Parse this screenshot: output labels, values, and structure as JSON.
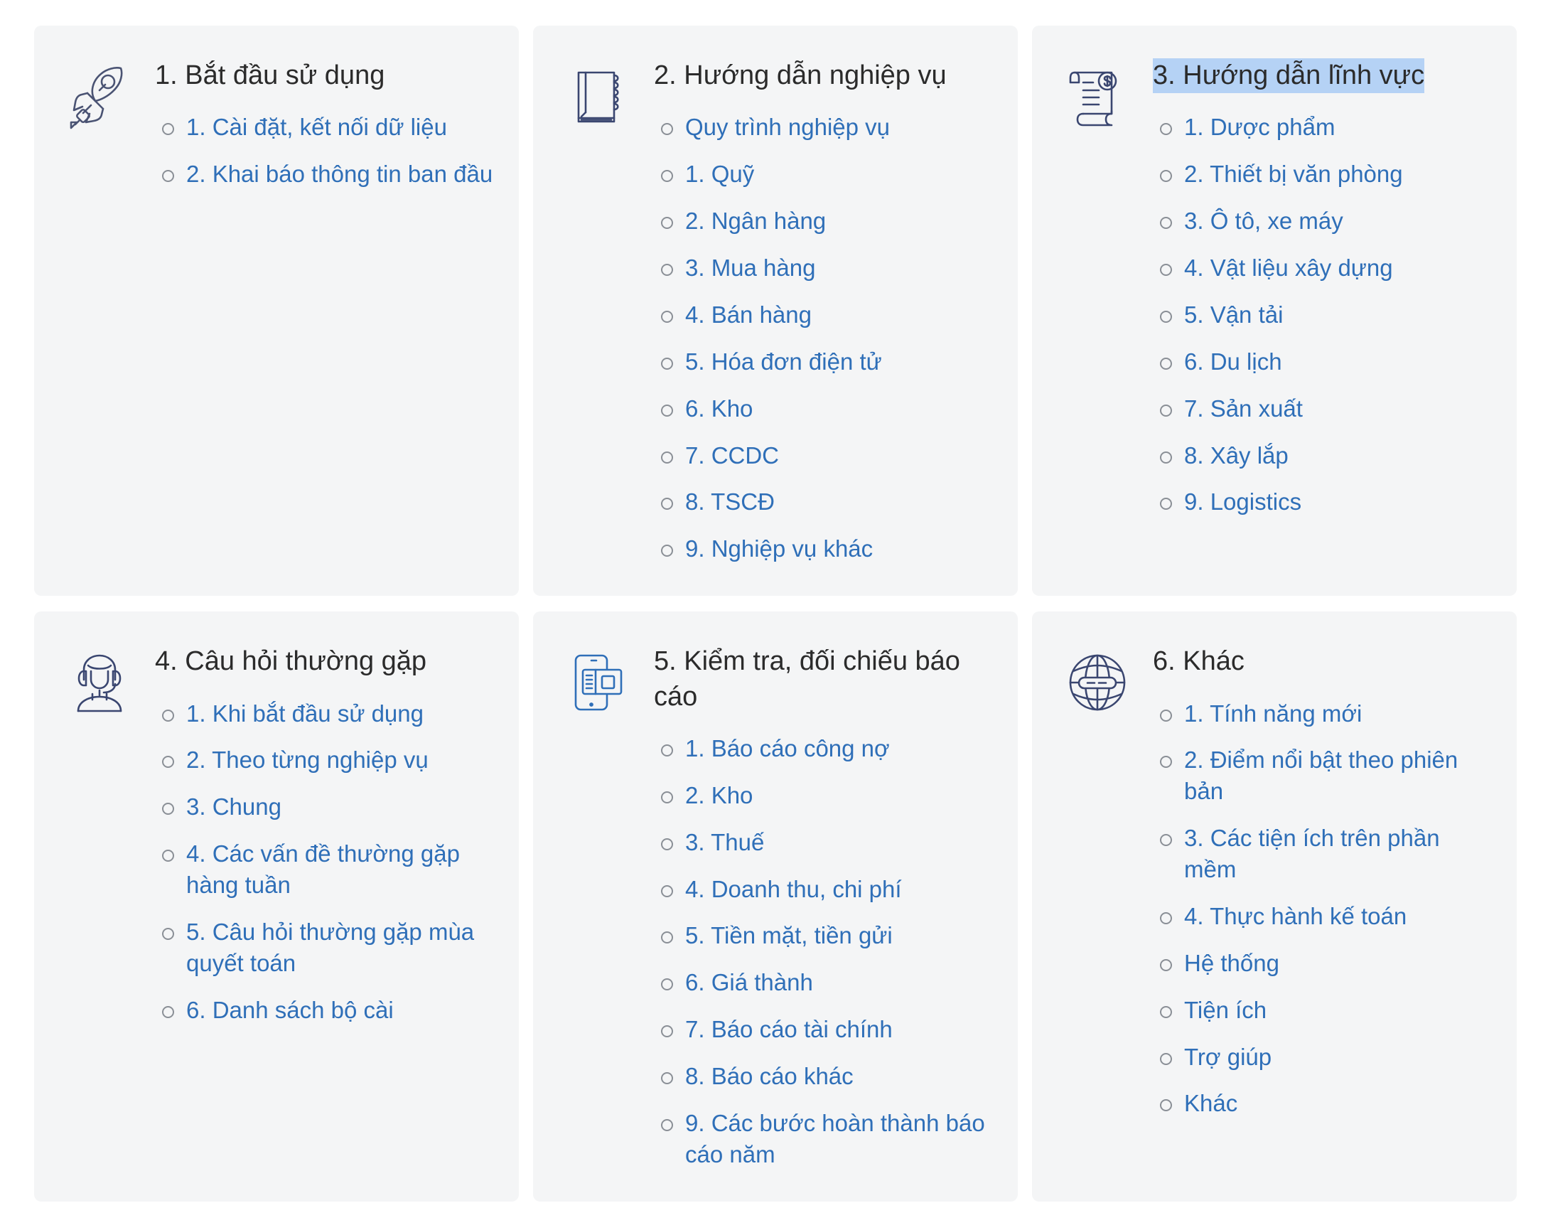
{
  "page": {
    "background": "#ffffff",
    "card_background": "#f4f5f6",
    "link_color": "#2f6fb8",
    "title_color": "#2b2b2b",
    "selection_highlight": "#b5d2f5",
    "bullet_color": "#8a8f96"
  },
  "cards": [
    {
      "icon": "rocket-icon",
      "title": "1. Bắt đầu sử dụng",
      "title_selected": false,
      "items": [
        "1. Cài đặt, kết nối dữ liệu",
        "2. Khai báo thông tin ban đầu"
      ]
    },
    {
      "icon": "notebook-icon",
      "title": "2. Hướng dẫn nghiệp vụ",
      "title_selected": false,
      "items": [
        "Quy trình nghiệp vụ",
        "1. Quỹ",
        "2. Ngân hàng",
        "3. Mua hàng",
        "4. Bán hàng",
        "5. Hóa đơn điện tử",
        "6. Kho",
        "7. CCDC",
        "8. TSCĐ",
        "9. Nghiệp vụ khác"
      ]
    },
    {
      "icon": "invoice-dollar-icon",
      "title": "3. Hướng dẫn lĩnh vực",
      "title_selected": true,
      "items": [
        "1. Dược phẩm",
        "2. Thiết bị văn phòng",
        "3. Ô tô, xe máy",
        "4. Vật liệu xây dựng",
        "5. Vận tải",
        "6. Du lịch",
        "7. Sản xuất",
        "8. Xây lắp",
        "9. Logistics"
      ]
    },
    {
      "icon": "support-agent-icon",
      "title": "4. Câu hỏi thường gặp",
      "title_selected": false,
      "items": [
        "1. Khi bắt đầu sử dụng",
        "2. Theo từng nghiệp vụ",
        "3. Chung",
        "4. Các vấn đề thường gặp hàng tuần",
        "5. Câu hỏi thường gặp mùa quyết toán",
        "6. Danh sách bộ cài"
      ]
    },
    {
      "icon": "mobile-report-icon",
      "title": "5. Kiểm tra, đối chiếu báo cáo",
      "title_selected": false,
      "items": [
        "1. Báo cáo công nợ",
        "2. Kho",
        "3. Thuế",
        "4. Doanh thu, chi phí",
        "5. Tiền mặt, tiền gửi",
        "6. Giá thành",
        "7. Báo cáo tài chính",
        "8. Báo cáo khác",
        "9. Các bước hoàn thành báo cáo năm"
      ]
    },
    {
      "icon": "globe-icon",
      "title": "6. Khác",
      "title_selected": false,
      "items": [
        "1. Tính năng mới",
        "2. Điểm nổi bật theo phiên bản",
        "3. Các tiện ích trên phần mềm",
        "4. Thực hành kế toán",
        "Hệ thống",
        "Tiện ích",
        "Trợ giúp",
        "Khác"
      ]
    }
  ]
}
